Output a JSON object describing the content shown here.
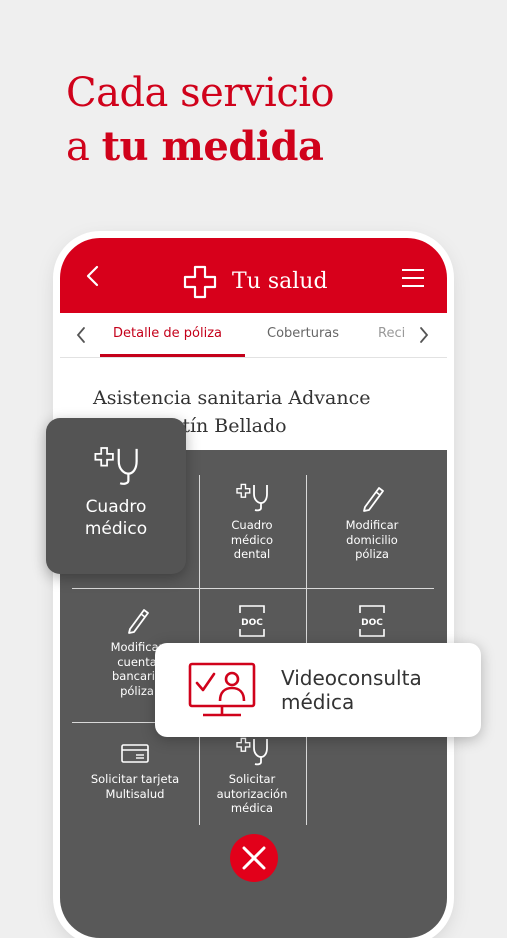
{
  "headline": {
    "line1": "Cada servicio",
    "line2_prefix": "a ",
    "line2_bold": "tu medida"
  },
  "app": {
    "header": {
      "title": "Tu salud"
    },
    "tabs": [
      {
        "label": "Detalle de póliza",
        "active": true
      },
      {
        "label": "Coberturas",
        "active": false
      },
      {
        "label": "Reci",
        "active": false
      }
    ],
    "policy": {
      "line1": "Asistencia sanitaria Advance",
      "line2": "Juan Martín Bellado"
    },
    "services": [
      {
        "label_lines": [
          "Cuadro",
          "médico",
          "dental"
        ],
        "icon": "stethoscope-icon"
      },
      {
        "label_lines": [
          "Modificar",
          "domicilio",
          "póliza"
        ],
        "icon": "pencil-icon"
      },
      {
        "label_lines": [
          "Modificar",
          "cuenta",
          "bancaria",
          "póliza"
        ],
        "icon": "pencil-icon"
      },
      {
        "label_lines": [
          "Solicitar tarjeta",
          "Multisalud"
        ],
        "icon": "card-icon"
      },
      {
        "label_lines": [
          "Solicitar",
          "autorización",
          "médica"
        ],
        "icon": "stethoscope-icon"
      }
    ],
    "doc_label": "DOC"
  },
  "featured": {
    "cuadro_medico": {
      "line1": "Cuadro",
      "line2": "médico",
      "icon": "stethoscope-icon"
    },
    "videoconsulta": {
      "line1": "Videoconsulta",
      "line2": "médica",
      "icon": "video-consultation-icon"
    }
  },
  "colors": {
    "brand_red": "#d7001b",
    "overlay_gray": "#595959"
  }
}
